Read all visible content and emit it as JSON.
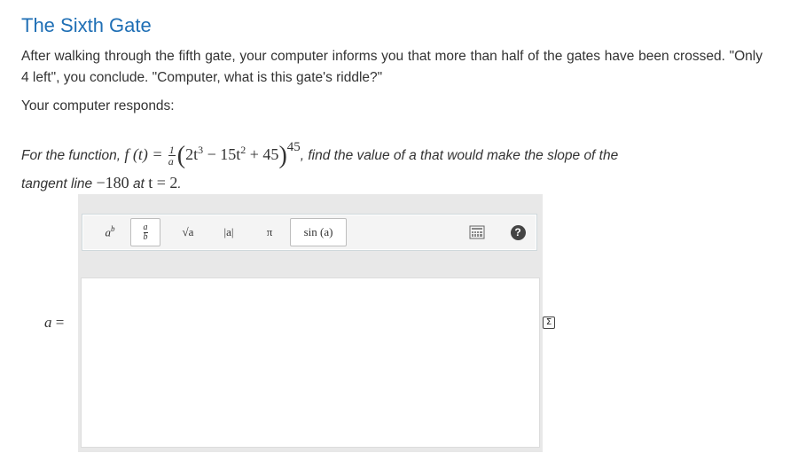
{
  "title": "The Sixth Gate",
  "intro": "After walking through the fifth gate, your computer informs you that more than half of the gates have been crossed. \"Only 4 left\", you conclude. \"Computer, what is this gate's riddle?\"",
  "responds": "Your computer responds:",
  "question": {
    "prefix": "For the function,",
    "func_lhs": "f (t) =",
    "frac_num": "1",
    "frac_den": "a",
    "poly_t1": "2t",
    "poly_exp1": "3",
    "poly_minus": " − 15t",
    "poly_exp2": "2",
    "poly_plus": " + 45",
    "outer_exp": "45",
    "suffix": ", find the value of a that would make the slope of the",
    "line2_a": "tangent line",
    "slope_value": "−180",
    "line2_at": "at",
    "t_eq": "t = 2",
    "period": "."
  },
  "toolbar": {
    "power": {
      "base": "a",
      "exp": "b"
    },
    "fraction": {
      "num": "a",
      "den": "b"
    },
    "sqrt": "√a",
    "abs": "|a|",
    "pi": "π",
    "sin": "sin (a)",
    "keyboard_icon": "keyboard-icon",
    "help_icon": "help-icon",
    "help_glyph": "?"
  },
  "answer": {
    "label_var": "a",
    "label_eq": "=",
    "value": ""
  },
  "sigma_glyph": "Σ"
}
